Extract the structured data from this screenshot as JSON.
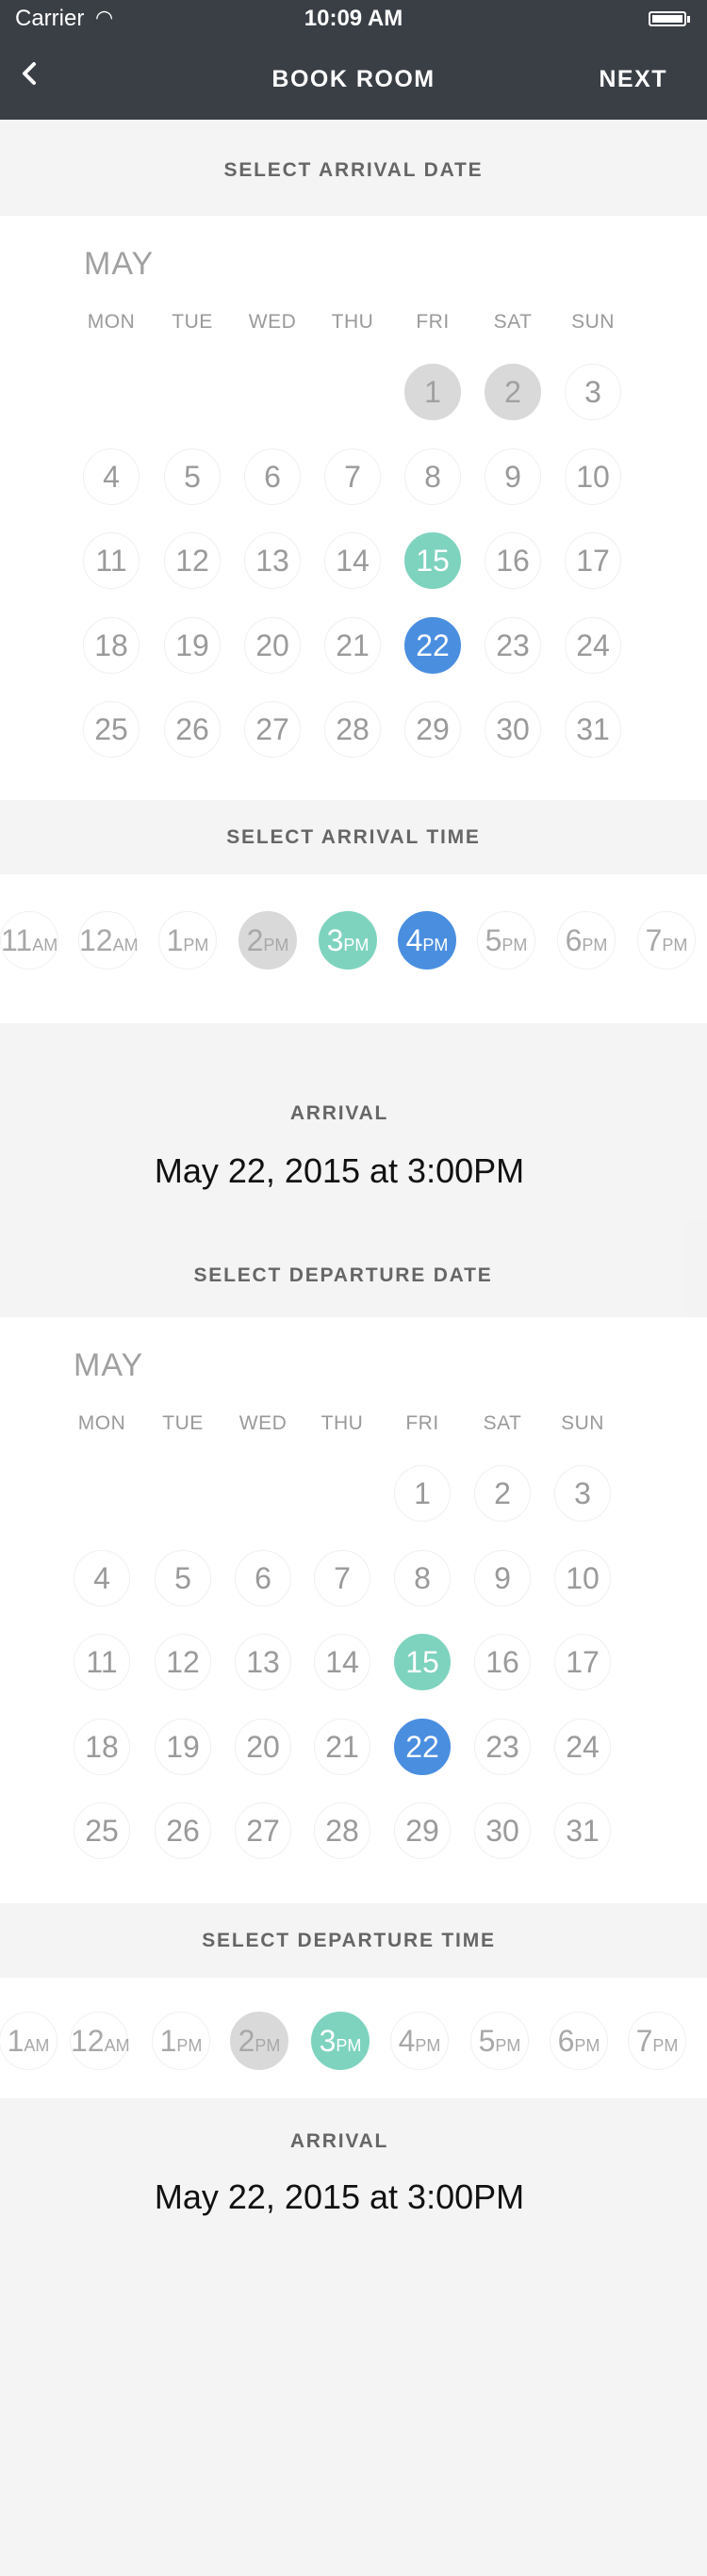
{
  "status_bar": {
    "carrier": "Carrier",
    "time": "10:09 AM"
  },
  "nav": {
    "back_icon": "chevron-left-icon",
    "title": "BOOK ROOM",
    "next": "NEXT"
  },
  "arrival_date": {
    "heading": "SELECT ARRIVAL DATE",
    "month": "MAY",
    "weekdays": [
      "MON",
      "TUE",
      "WED",
      "THU",
      "FRI",
      "SAT",
      "SUN"
    ],
    "rows": [
      [
        null,
        null,
        null,
        null,
        "1",
        "2",
        "3"
      ],
      [
        "4",
        "5",
        "6",
        "7",
        "8",
        "9",
        "10"
      ],
      [
        "11",
        "12",
        "13",
        "14",
        "15",
        "16",
        "17"
      ],
      [
        "18",
        "19",
        "20",
        "21",
        "22",
        "23",
        "24"
      ],
      [
        "25",
        "26",
        "27",
        "28",
        "29",
        "30",
        "31"
      ]
    ],
    "unavailable": [
      "1",
      "2"
    ],
    "today": "15",
    "selected": "22"
  },
  "arrival_time": {
    "heading": "SELECT ARRIVAL TIME",
    "times": [
      {
        "h": "11",
        "m": "AM"
      },
      {
        "h": "12",
        "m": "AM"
      },
      {
        "h": "1",
        "m": "PM"
      },
      {
        "h": "2",
        "m": "PM"
      },
      {
        "h": "3",
        "m": "PM"
      },
      {
        "h": "4",
        "m": "PM"
      },
      {
        "h": "5",
        "m": "PM"
      },
      {
        "h": "6",
        "m": "PM"
      },
      {
        "h": "7",
        "m": "PM"
      }
    ],
    "unavailable": [
      3
    ],
    "highlight": [
      4
    ],
    "selected": [
      5
    ]
  },
  "arrival_summary": {
    "label": "ARRIVAL",
    "value": "May 22, 2015 at 3:00PM"
  },
  "departure_date": {
    "heading": "SELECT DEPARTURE DATE",
    "month": "MAY",
    "weekdays": [
      "MON",
      "TUE",
      "WED",
      "THU",
      "FRI",
      "SAT",
      "SUN"
    ],
    "rows": [
      [
        null,
        null,
        null,
        null,
        "1",
        "2",
        "3"
      ],
      [
        "4",
        "5",
        "6",
        "7",
        "8",
        "9",
        "10"
      ],
      [
        "11",
        "12",
        "13",
        "14",
        "15",
        "16",
        "17"
      ],
      [
        "18",
        "19",
        "20",
        "21",
        "22",
        "23",
        "24"
      ],
      [
        "25",
        "26",
        "27",
        "28",
        "29",
        "30",
        "31"
      ]
    ],
    "unavailable": [],
    "today": "15",
    "selected": "22"
  },
  "departure_time": {
    "heading": "SELECT DEPARTURE TIME",
    "times": [
      {
        "h": "1",
        "m": "AM"
      },
      {
        "h": "12",
        "m": "AM"
      },
      {
        "h": "1",
        "m": "PM"
      },
      {
        "h": "2",
        "m": "PM"
      },
      {
        "h": "3",
        "m": "PM"
      },
      {
        "h": "4",
        "m": "PM"
      },
      {
        "h": "5",
        "m": "PM"
      },
      {
        "h": "6",
        "m": "PM"
      },
      {
        "h": "7",
        "m": "PM"
      }
    ],
    "unavailable": [
      3
    ],
    "highlight": [
      4
    ],
    "selected": []
  },
  "departure_summary": {
    "label": "ARRIVAL",
    "value": "May 22, 2015 at 3:00PM"
  },
  "colors": {
    "nav": "#3a3f46",
    "green": "#7ed3bf",
    "blue": "#4a8ee0",
    "gray": "#d9d9d9"
  }
}
